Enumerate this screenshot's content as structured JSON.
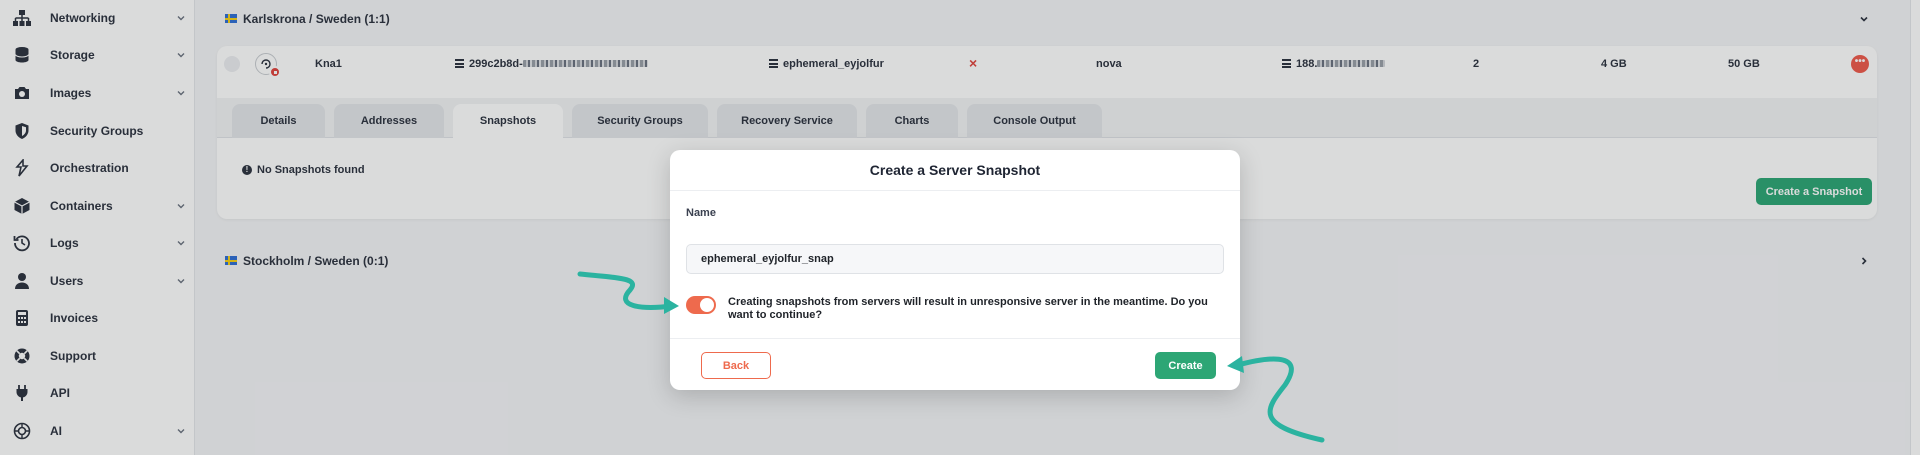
{
  "sidebar": {
    "items": [
      {
        "label": "Networking",
        "icon": "network-icon",
        "has_children": true
      },
      {
        "label": "Storage",
        "icon": "database-icon",
        "has_children": true
      },
      {
        "label": "Images",
        "icon": "camera-icon",
        "has_children": true
      },
      {
        "label": "Security Groups",
        "icon": "shield-icon",
        "has_children": false
      },
      {
        "label": "Orchestration",
        "icon": "layers-icon",
        "has_children": false
      },
      {
        "label": "Containers",
        "icon": "box-icon",
        "has_children": true
      },
      {
        "label": "Logs",
        "icon": "history-icon",
        "has_children": true
      },
      {
        "label": "Users",
        "icon": "user-icon",
        "has_children": true
      },
      {
        "label": "Invoices",
        "icon": "calculator-icon",
        "has_children": false
      },
      {
        "label": "Support",
        "icon": "lifebuoy-icon",
        "has_children": false
      },
      {
        "label": "API",
        "icon": "plug-icon",
        "has_children": false
      },
      {
        "label": "AI",
        "icon": "ai-icon",
        "has_children": true
      }
    ]
  },
  "regions": {
    "karlskrona": "Karlskrona / Sweden (1:1)",
    "stockholm": "Stockholm / Sweden (0:1)"
  },
  "server": {
    "name": "Kna1",
    "id_prefix": "299c2b8d-",
    "volume": "ephemeral_eyjolfur",
    "zone": "nova",
    "ip_prefix": "188.",
    "vcpus": "2",
    "ram": "4 GB",
    "disk": "50 GB"
  },
  "tabs": [
    {
      "label": "Details",
      "active": false
    },
    {
      "label": "Addresses",
      "active": false
    },
    {
      "label": "Snapshots",
      "active": true
    },
    {
      "label": "Security Groups",
      "active": false
    },
    {
      "label": "Recovery Service",
      "active": false
    },
    {
      "label": "Charts",
      "active": false
    },
    {
      "label": "Console Output",
      "active": false
    }
  ],
  "snapshots_panel": {
    "empty_text": "No Snapshots found",
    "create_button": "Create a Snapshot"
  },
  "modal": {
    "title": "Create a Server Snapshot",
    "name_label": "Name",
    "name_value": "ephemeral_eyjolfur_snap",
    "toggle_on": true,
    "warning": "Creating snapshots from servers will result in unresponsive server in the meantime. Do you want to continue?",
    "back_label": "Back",
    "create_label": "Create"
  },
  "colors": {
    "accent_green": "#2da675",
    "accent_orange": "#ee6a4d",
    "danger_red": "#e0443e",
    "annotation_teal": "#2bb3a0"
  }
}
